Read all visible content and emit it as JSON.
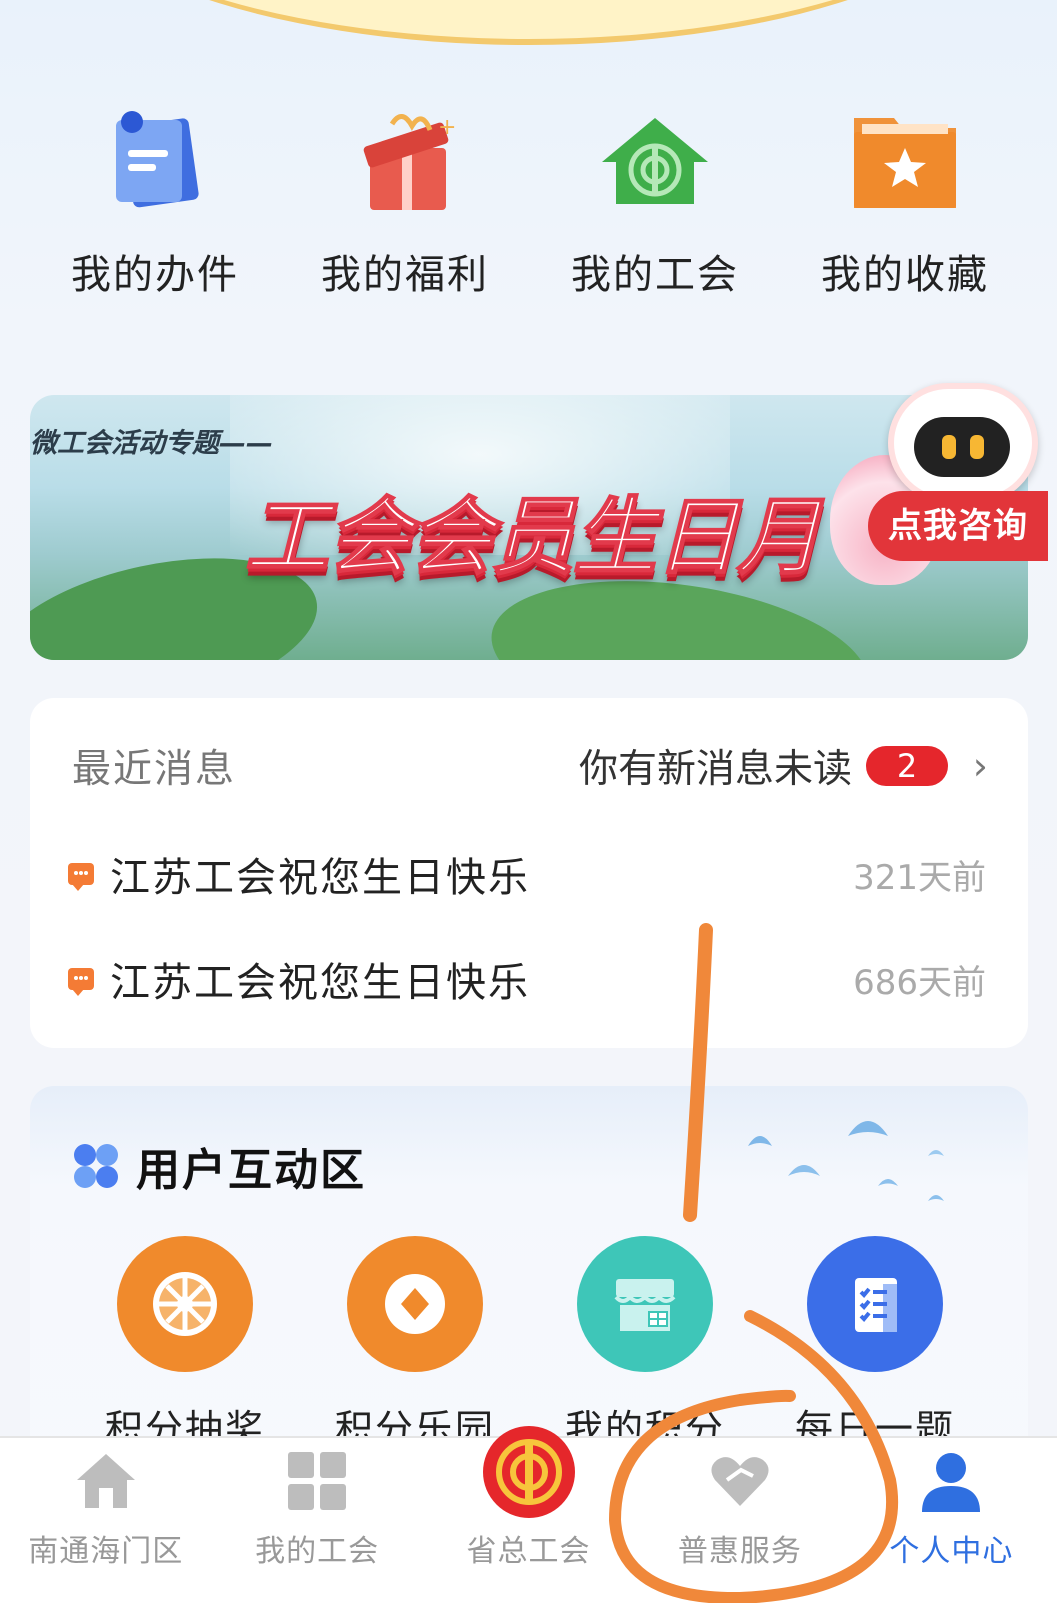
{
  "shortcuts": [
    {
      "label": "我的办件",
      "icon": "document-icon"
    },
    {
      "label": "我的福利",
      "icon": "gift-icon"
    },
    {
      "label": "我的工会",
      "icon": "union-house-icon"
    },
    {
      "label": "我的收藏",
      "icon": "star-folder-icon"
    }
  ],
  "banner": {
    "subtitle": "微工会活动专题——",
    "title": "工会会员生日月",
    "consult_label": "点我咨询"
  },
  "messages": {
    "title": "最近消息",
    "unread_text": "你有新消息未读",
    "unread_count": "2",
    "items": [
      {
        "text": "江苏工会祝您生日快乐",
        "time": "321天前"
      },
      {
        "text": "江苏工会祝您生日快乐",
        "time": "686天前"
      }
    ]
  },
  "interaction": {
    "title": "用户互动区",
    "items": [
      {
        "label": "积分抽奖",
        "icon": "lottery-wheel-icon",
        "color": "#f08a2c"
      },
      {
        "label": "积分乐园",
        "icon": "coin-icon",
        "color": "#f08a2c"
      },
      {
        "label": "我的积分",
        "icon": "store-icon",
        "color": "#3ec6b8"
      },
      {
        "label": "每日一题",
        "icon": "checklist-icon",
        "color": "#3b6ee8"
      }
    ]
  },
  "bottom_nav": [
    {
      "label": "南通海门区",
      "icon": "home-icon",
      "active": false
    },
    {
      "label": "我的工会",
      "icon": "grid-icon",
      "active": false
    },
    {
      "label": "省总工会",
      "icon": "union-emblem-icon",
      "active": false
    },
    {
      "label": "普惠服务",
      "icon": "heart-icon",
      "active": false
    },
    {
      "label": "个人中心",
      "icon": "user-icon",
      "active": true
    }
  ],
  "colors": {
    "accent_blue": "#2f6fe0",
    "badge_red": "#e5262c",
    "annotation_orange": "#f0883a"
  }
}
